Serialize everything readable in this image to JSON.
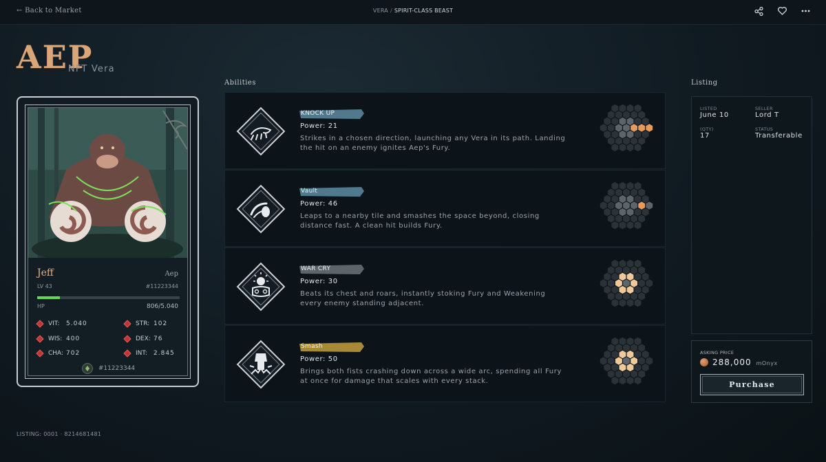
{
  "topbar": {
    "back_label": "← Back to Market",
    "breadcrumb_parent": "VERA",
    "breadcrumb_sep": "/",
    "breadcrumb_current": "SPIRIT-CLASS BEAST",
    "icons": [
      "share-icon",
      "heart-icon",
      "more-icon"
    ]
  },
  "title": {
    "main": "AEP",
    "subtitle": "NFT Vera"
  },
  "card": {
    "name": "Jeff",
    "species": "Aep",
    "level": "LV 43",
    "id": "#11223344",
    "hp_label": "HP",
    "hp_value": "806/5.040",
    "hp_fraction": 0.16,
    "stats": [
      {
        "name": "VIT:",
        "value": "5.040"
      },
      {
        "name": "STR:",
        "value": "102"
      },
      {
        "name": "WIS:",
        "value": "400"
      },
      {
        "name": "DEX:",
        "value": "76"
      },
      {
        "name": "CHA:",
        "value": "702"
      },
      {
        "name": "INT:",
        "value": "2.845"
      }
    ],
    "owner_id": "#11223344"
  },
  "abilities_heading": "Abilities",
  "abilities": [
    {
      "name": "KNOCK UP",
      "power": "Power: 21",
      "desc": "Strikes in a chosen direction, launching any Vera in its path. Landing the hit on an enemy ignites Aep's Fury.",
      "icon": "knock-up-icon",
      "tag_color": "#5e8ba3"
    },
    {
      "name": "Vault",
      "power": "Power: 46",
      "desc": "Leaps to a nearby tile and smashes the space beyond, closing distance fast. A clean hit builds Fury.",
      "icon": "vault-icon",
      "tag_color": "#5e8ba3"
    },
    {
      "name": "WAR CRY",
      "power": "Power: 30",
      "desc": "Beats its chest and roars, instantly stoking Fury and Weakening every enemy standing adjacent.",
      "icon": "war-cry-icon",
      "tag_color": "#6b7378"
    },
    {
      "name": "Smash",
      "power": "Power: 50",
      "desc": "Brings both fists crashing down across a wide arc, spending all Fury at once for damage that scales with every stack.",
      "icon": "smash-icon",
      "tag_color": "#b9973a"
    }
  ],
  "listing_heading": "Listing",
  "listing": {
    "listed_label": "LISTED",
    "listed_value": "June 10",
    "seller_label": "SELLER",
    "seller_value": "Lord T",
    "qty_label": "(QTY)",
    "qty_value": "17",
    "status_label": "STATUS",
    "status_value": "Transferable"
  },
  "price": {
    "label": "ASKING PRICE",
    "value": "288,000",
    "unit": "mOnyx",
    "button_label": "Purchase"
  },
  "footer": "LISTING: 0001 · 8214681481",
  "colors": {
    "accent": "#d9a67a",
    "hp_bar": "#6ad45a",
    "stat_gem": "#c03434",
    "hex_active": "#f0c99a",
    "hex_target": "#e89a5a"
  }
}
